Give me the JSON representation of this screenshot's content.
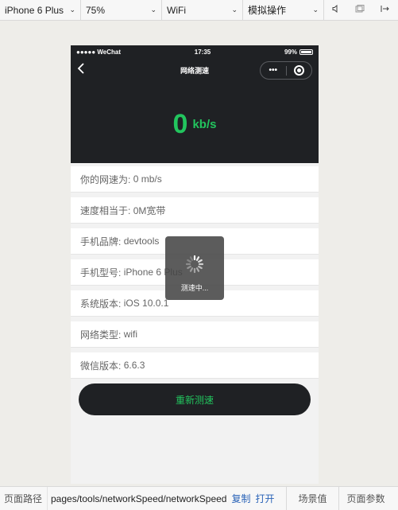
{
  "toolbar": {
    "device": "iPhone 6 Plus",
    "zoom": "75%",
    "network": "WiFi",
    "operations": "模拟操作"
  },
  "phone": {
    "status": {
      "carrier": "●●●●● WeChat",
      "time": "17:35",
      "battery": "99%"
    },
    "nav": {
      "title": "网络测速",
      "more": "•••"
    },
    "speed": {
      "value": "0",
      "unit": "kb/s"
    },
    "info": [
      {
        "label": "你的网速为:",
        "value": "0 mb/s"
      },
      {
        "label": "速度相当于:",
        "value": "0M宽带"
      },
      {
        "label": "手机品牌:",
        "value": "devtools"
      },
      {
        "label": "手机型号:",
        "value": "iPhone 6 Plus"
      },
      {
        "label": "系统版本:",
        "value": "iOS 10.0.1"
      },
      {
        "label": "网络类型:",
        "value": "wifi"
      },
      {
        "label": "微信版本:",
        "value": "6.6.3"
      }
    ],
    "retest_label": "重新测速",
    "toast": "测速中..."
  },
  "bottombar": {
    "path_label": "页面路径",
    "path": "pages/tools/networkSpeed/networkSpeed",
    "copy": "复制",
    "open": "打开",
    "scene": "场景值",
    "params": "页面参数"
  },
  "colors": {
    "accent": "#22c55e",
    "dark": "#1f2124",
    "link": "#2b64b8"
  }
}
